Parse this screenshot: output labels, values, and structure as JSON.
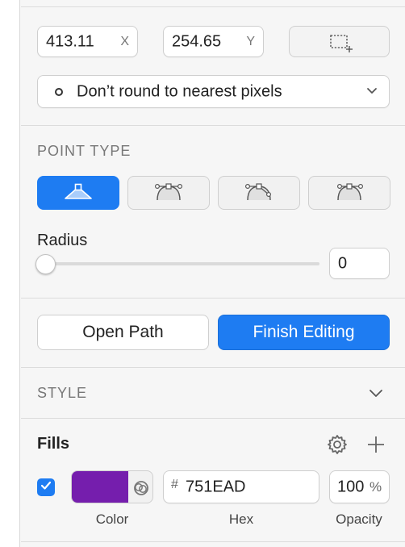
{
  "position": {
    "x": {
      "value": "413.11",
      "suffix": "X"
    },
    "y": {
      "value": "254.65",
      "suffix": "Y"
    }
  },
  "rounding": {
    "selected": "Don’t round to nearest pixels"
  },
  "point_type": {
    "title": "POINT TYPE",
    "options": [
      {
        "icon": "straight-point-icon",
        "active": true
      },
      {
        "icon": "mirrored-point-icon",
        "active": false
      },
      {
        "icon": "disconnected-point-icon",
        "active": false
      },
      {
        "icon": "asymmetric-point-icon",
        "active": false
      }
    ]
  },
  "radius": {
    "label": "Radius",
    "value": "0",
    "slider_fraction": 0
  },
  "actions": {
    "open_path": "Open Path",
    "finish_editing": "Finish Editing"
  },
  "style": {
    "title": "STYLE"
  },
  "fills": {
    "title": "Fills",
    "enabled": true,
    "color": "#751EAD",
    "hex_prefix": "#",
    "hex_value": "751EAD",
    "opacity_value": "100",
    "opacity_unit": "%",
    "captions": {
      "color": "Color",
      "hex": "Hex",
      "opacity": "Opacity"
    }
  },
  "colors": {
    "accent": "#1E7CF2",
    "fill": "#751EAD"
  }
}
